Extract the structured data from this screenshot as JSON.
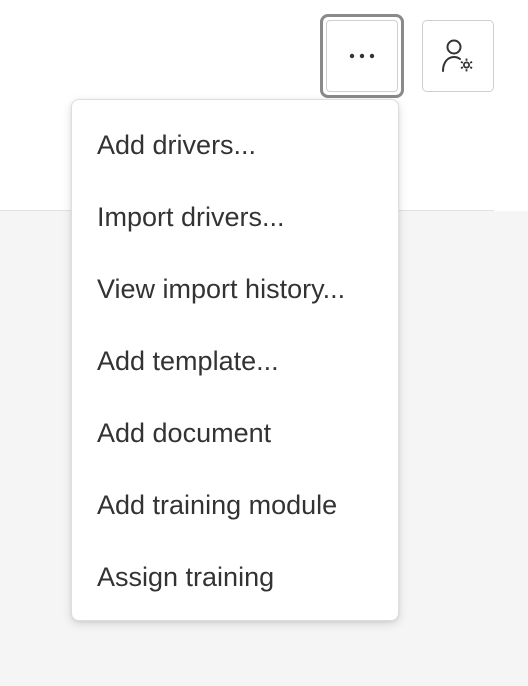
{
  "toolbar": {
    "more_icon": "ellipsis-horizontal-icon",
    "user_settings_icon": "user-gear-icon"
  },
  "menu": {
    "items": [
      {
        "label": "Add drivers..."
      },
      {
        "label": "Import drivers..."
      },
      {
        "label": "View import history..."
      },
      {
        "label": "Add template..."
      },
      {
        "label": "Add document"
      },
      {
        "label": "Add training module"
      },
      {
        "label": "Assign training"
      }
    ]
  },
  "colors": {
    "text": "#333333",
    "page_background": "#f5f5f5",
    "focus_ring": "#8a8a8a",
    "border": "#cfcfcf"
  }
}
